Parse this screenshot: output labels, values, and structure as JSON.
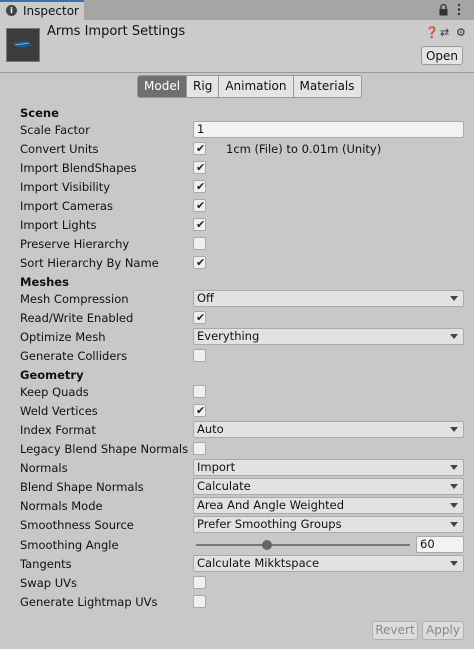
{
  "window": {
    "tab_label": "Inspector",
    "icons": [
      "info-icon",
      "lock-icon",
      "kebab-menu-icon"
    ]
  },
  "header": {
    "title": "Arms Import Settings",
    "open_label": "Open",
    "icons": [
      "help-icon",
      "preset-icon",
      "gear-icon"
    ]
  },
  "toolbar": {
    "model": "Model",
    "rig": "Rig",
    "animation": "Animation",
    "materials": "Materials",
    "active": "Model"
  },
  "settings": {
    "scene": "Scene",
    "scale_factor": {
      "label": "Scale Factor",
      "value": "1"
    },
    "convert_units": {
      "label": "Convert Units",
      "checked": true,
      "note": "1cm (File) to 0.01m (Unity)"
    },
    "import_blendshapes": {
      "label": "Import BlendShapes",
      "checked": true
    },
    "import_visibility": {
      "label": "Import Visibility",
      "checked": true
    },
    "import_cameras": {
      "label": "Import Cameras",
      "checked": true
    },
    "import_lights": {
      "label": "Import Lights",
      "checked": true
    },
    "preserve_hierarchy": {
      "label": "Preserve Hierarchy",
      "checked": false
    },
    "sort_hierarchy": {
      "label": "Sort Hierarchy By Name",
      "checked": true
    },
    "meshes": "Meshes",
    "mesh_compression": {
      "label": "Mesh Compression",
      "value": "Off"
    },
    "read_write": {
      "label": "Read/Write Enabled",
      "checked": true
    },
    "optimize_mesh": {
      "label": "Optimize Mesh",
      "value": "Everything"
    },
    "generate_colliders": {
      "label": "Generate Colliders",
      "checked": false
    },
    "geometry": "Geometry",
    "keep_quads": {
      "label": "Keep Quads",
      "checked": false
    },
    "weld_vertices": {
      "label": "Weld Vertices",
      "checked": true
    },
    "index_format": {
      "label": "Index Format",
      "value": "Auto"
    },
    "legacy_blend": {
      "label": "Legacy Blend Shape Normals",
      "checked": false
    },
    "normals": {
      "label": "Normals",
      "value": "Import"
    },
    "blend_shape_normals": {
      "label": "Blend Shape Normals",
      "value": "Calculate"
    },
    "normals_mode": {
      "label": "Normals Mode",
      "value": "Area And Angle Weighted"
    },
    "smoothness_source": {
      "label": "Smoothness Source",
      "value": "Prefer Smoothing Groups"
    },
    "smoothing_angle": {
      "label": "Smoothing Angle",
      "value": "60",
      "min": 0,
      "max": 180
    },
    "tangents": {
      "label": "Tangents",
      "value": "Calculate Mikktspace"
    },
    "swap_uvs": {
      "label": "Swap UVs",
      "checked": false
    },
    "lightmap_uvs": {
      "label": "Generate Lightmap UVs",
      "checked": false
    }
  },
  "footer": {
    "revert": "Revert",
    "apply": "Apply"
  },
  "colors": {
    "tab_accent": "#3a72b0",
    "active_segment": "#6f6f6f",
    "panel": "#c8c8c8"
  }
}
